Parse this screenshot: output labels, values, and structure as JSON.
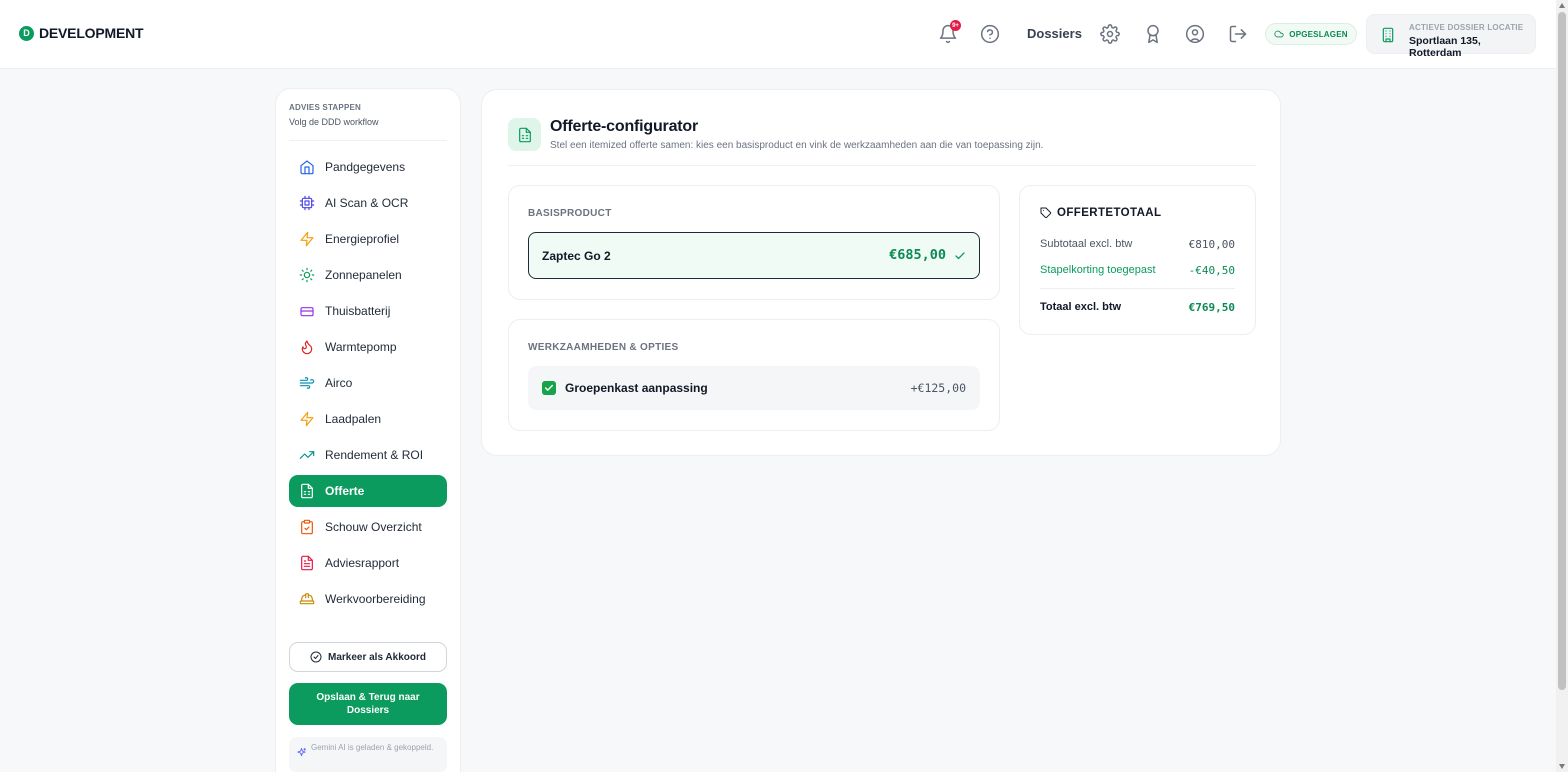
{
  "header": {
    "brand_letter": "D",
    "brand_name": "DEVELOPMENT",
    "notification_count": "9+",
    "nav_dossiers": "Dossiers",
    "saved_status": "OPGESLAGEN",
    "location_label": "ACTIEVE DOSSIER LOCATIE",
    "location_value": "Sportlaan 135, Rotterdam"
  },
  "sidebar": {
    "title": "ADVIES STAPPEN",
    "subtitle": "Volg de DDD workflow",
    "items": [
      {
        "label": "Pandgegevens",
        "icon": "home-icon"
      },
      {
        "label": "AI Scan & OCR",
        "icon": "cpu-icon"
      },
      {
        "label": "Energieprofiel",
        "icon": "bolt-icon"
      },
      {
        "label": "Zonnepanelen",
        "icon": "sun-icon"
      },
      {
        "label": "Thuisbatterij",
        "icon": "battery-icon"
      },
      {
        "label": "Warmtepomp",
        "icon": "flame-icon"
      },
      {
        "label": "Airco",
        "icon": "wind-icon"
      },
      {
        "label": "Laadpalen",
        "icon": "bolt-icon"
      },
      {
        "label": "Rendement & ROI",
        "icon": "trending-up-icon"
      },
      {
        "label": "Offerte",
        "icon": "document-icon",
        "active": true
      },
      {
        "label": "Schouw Overzicht",
        "icon": "clipboard-icon"
      },
      {
        "label": "Adviesrapport",
        "icon": "report-icon"
      },
      {
        "label": "Werkvoorbereiding",
        "icon": "hardhat-icon"
      }
    ],
    "approve_label": "Markeer als Akkoord",
    "save_label": "Opslaan & Terug naar Dossiers",
    "ai_note": "Gemini AI is geladen & gekoppeld."
  },
  "main": {
    "title": "Offerte-configurator",
    "subtitle": "Stel een itemized offerte samen: kies een basisproduct en vink de werkzaamheden aan die van toepassing zijn.",
    "base_label": "BASISPRODUCT",
    "base_product": {
      "name": "Zaptec Go 2",
      "price": "€685,00"
    },
    "options_label": "WERKZAAMHEDEN & OPTIES",
    "options": [
      {
        "label": "Groepenkast aanpassing",
        "price": "+€125,00",
        "checked": true
      }
    ],
    "totals": {
      "title": "OFFERTETOTAAL",
      "subtotal_label": "Subtotaal excl. btw",
      "subtotal_value": "€810,00",
      "discount_label": "Stapelkorting toegepast",
      "discount_value": "-€40,50",
      "total_label": "Totaal excl. btw",
      "total_value": "€769,50"
    }
  },
  "colors": {
    "accent": "#0b9b5e",
    "accent_text": "#0b8a53",
    "notification": "#e11d48"
  }
}
